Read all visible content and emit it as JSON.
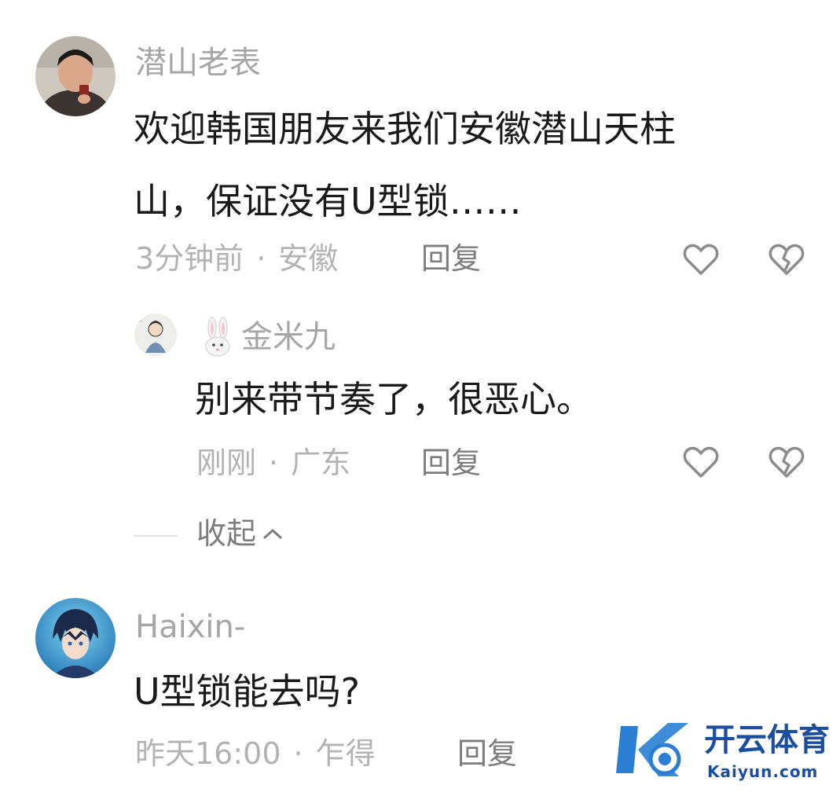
{
  "comments": [
    {
      "username": "潜山老表",
      "text_line1": "欢迎韩国朋友来我们安徽潜山天柱",
      "text_line2": "山，保证没有U型锁……",
      "time": "3分钟前",
      "location": "安徽",
      "reply_label": "回复",
      "sub_reply": {
        "username": "金米九",
        "text": "别来带节奏了，很恶心。",
        "time": "刚刚",
        "location": "广东",
        "reply_label": "回复"
      },
      "collapse_label": "收起"
    },
    {
      "username": "Haixin-",
      "text": "U型锁能去吗?",
      "time": "昨天16:00",
      "location": "乍得",
      "reply_label": "回复"
    }
  ],
  "separator": "·",
  "watermark": {
    "title": "开云体育",
    "subtitle": "Kaiyun.com"
  },
  "colors": {
    "username": "#a6a6a6",
    "content": "#1a1a1a",
    "meta": "#b3b3b3",
    "reply": "#7d7d7d",
    "icon": "#8c8c8c",
    "watermark": "#1b4e9e"
  },
  "icons": [
    "heart-icon",
    "broken-heart-icon",
    "chevron-up-icon",
    "rabbit-icon"
  ]
}
